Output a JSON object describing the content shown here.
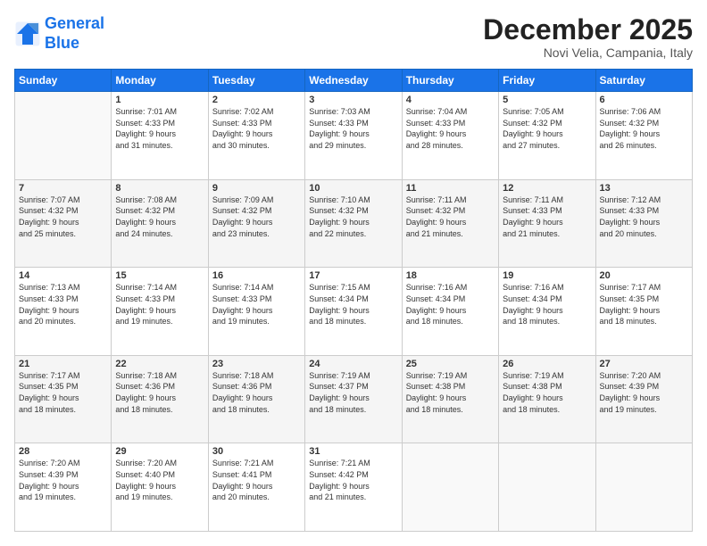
{
  "header": {
    "logo_line1": "General",
    "logo_line2": "Blue",
    "month": "December 2025",
    "location": "Novi Velia, Campania, Italy"
  },
  "days_of_week": [
    "Sunday",
    "Monday",
    "Tuesday",
    "Wednesday",
    "Thursday",
    "Friday",
    "Saturday"
  ],
  "weeks": [
    [
      {
        "num": "",
        "info": ""
      },
      {
        "num": "1",
        "info": "Sunrise: 7:01 AM\nSunset: 4:33 PM\nDaylight: 9 hours\nand 31 minutes."
      },
      {
        "num": "2",
        "info": "Sunrise: 7:02 AM\nSunset: 4:33 PM\nDaylight: 9 hours\nand 30 minutes."
      },
      {
        "num": "3",
        "info": "Sunrise: 7:03 AM\nSunset: 4:33 PM\nDaylight: 9 hours\nand 29 minutes."
      },
      {
        "num": "4",
        "info": "Sunrise: 7:04 AM\nSunset: 4:33 PM\nDaylight: 9 hours\nand 28 minutes."
      },
      {
        "num": "5",
        "info": "Sunrise: 7:05 AM\nSunset: 4:32 PM\nDaylight: 9 hours\nand 27 minutes."
      },
      {
        "num": "6",
        "info": "Sunrise: 7:06 AM\nSunset: 4:32 PM\nDaylight: 9 hours\nand 26 minutes."
      }
    ],
    [
      {
        "num": "7",
        "info": "Sunrise: 7:07 AM\nSunset: 4:32 PM\nDaylight: 9 hours\nand 25 minutes."
      },
      {
        "num": "8",
        "info": "Sunrise: 7:08 AM\nSunset: 4:32 PM\nDaylight: 9 hours\nand 24 minutes."
      },
      {
        "num": "9",
        "info": "Sunrise: 7:09 AM\nSunset: 4:32 PM\nDaylight: 9 hours\nand 23 minutes."
      },
      {
        "num": "10",
        "info": "Sunrise: 7:10 AM\nSunset: 4:32 PM\nDaylight: 9 hours\nand 22 minutes."
      },
      {
        "num": "11",
        "info": "Sunrise: 7:11 AM\nSunset: 4:32 PM\nDaylight: 9 hours\nand 21 minutes."
      },
      {
        "num": "12",
        "info": "Sunrise: 7:11 AM\nSunset: 4:33 PM\nDaylight: 9 hours\nand 21 minutes."
      },
      {
        "num": "13",
        "info": "Sunrise: 7:12 AM\nSunset: 4:33 PM\nDaylight: 9 hours\nand 20 minutes."
      }
    ],
    [
      {
        "num": "14",
        "info": "Sunrise: 7:13 AM\nSunset: 4:33 PM\nDaylight: 9 hours\nand 20 minutes."
      },
      {
        "num": "15",
        "info": "Sunrise: 7:14 AM\nSunset: 4:33 PM\nDaylight: 9 hours\nand 19 minutes."
      },
      {
        "num": "16",
        "info": "Sunrise: 7:14 AM\nSunset: 4:33 PM\nDaylight: 9 hours\nand 19 minutes."
      },
      {
        "num": "17",
        "info": "Sunrise: 7:15 AM\nSunset: 4:34 PM\nDaylight: 9 hours\nand 18 minutes."
      },
      {
        "num": "18",
        "info": "Sunrise: 7:16 AM\nSunset: 4:34 PM\nDaylight: 9 hours\nand 18 minutes."
      },
      {
        "num": "19",
        "info": "Sunrise: 7:16 AM\nSunset: 4:34 PM\nDaylight: 9 hours\nand 18 minutes."
      },
      {
        "num": "20",
        "info": "Sunrise: 7:17 AM\nSunset: 4:35 PM\nDaylight: 9 hours\nand 18 minutes."
      }
    ],
    [
      {
        "num": "21",
        "info": "Sunrise: 7:17 AM\nSunset: 4:35 PM\nDaylight: 9 hours\nand 18 minutes."
      },
      {
        "num": "22",
        "info": "Sunrise: 7:18 AM\nSunset: 4:36 PM\nDaylight: 9 hours\nand 18 minutes."
      },
      {
        "num": "23",
        "info": "Sunrise: 7:18 AM\nSunset: 4:36 PM\nDaylight: 9 hours\nand 18 minutes."
      },
      {
        "num": "24",
        "info": "Sunrise: 7:19 AM\nSunset: 4:37 PM\nDaylight: 9 hours\nand 18 minutes."
      },
      {
        "num": "25",
        "info": "Sunrise: 7:19 AM\nSunset: 4:38 PM\nDaylight: 9 hours\nand 18 minutes."
      },
      {
        "num": "26",
        "info": "Sunrise: 7:19 AM\nSunset: 4:38 PM\nDaylight: 9 hours\nand 18 minutes."
      },
      {
        "num": "27",
        "info": "Sunrise: 7:20 AM\nSunset: 4:39 PM\nDaylight: 9 hours\nand 19 minutes."
      }
    ],
    [
      {
        "num": "28",
        "info": "Sunrise: 7:20 AM\nSunset: 4:39 PM\nDaylight: 9 hours\nand 19 minutes."
      },
      {
        "num": "29",
        "info": "Sunrise: 7:20 AM\nSunset: 4:40 PM\nDaylight: 9 hours\nand 19 minutes."
      },
      {
        "num": "30",
        "info": "Sunrise: 7:21 AM\nSunset: 4:41 PM\nDaylight: 9 hours\nand 20 minutes."
      },
      {
        "num": "31",
        "info": "Sunrise: 7:21 AM\nSunset: 4:42 PM\nDaylight: 9 hours\nand 21 minutes."
      },
      {
        "num": "",
        "info": ""
      },
      {
        "num": "",
        "info": ""
      },
      {
        "num": "",
        "info": ""
      }
    ]
  ]
}
